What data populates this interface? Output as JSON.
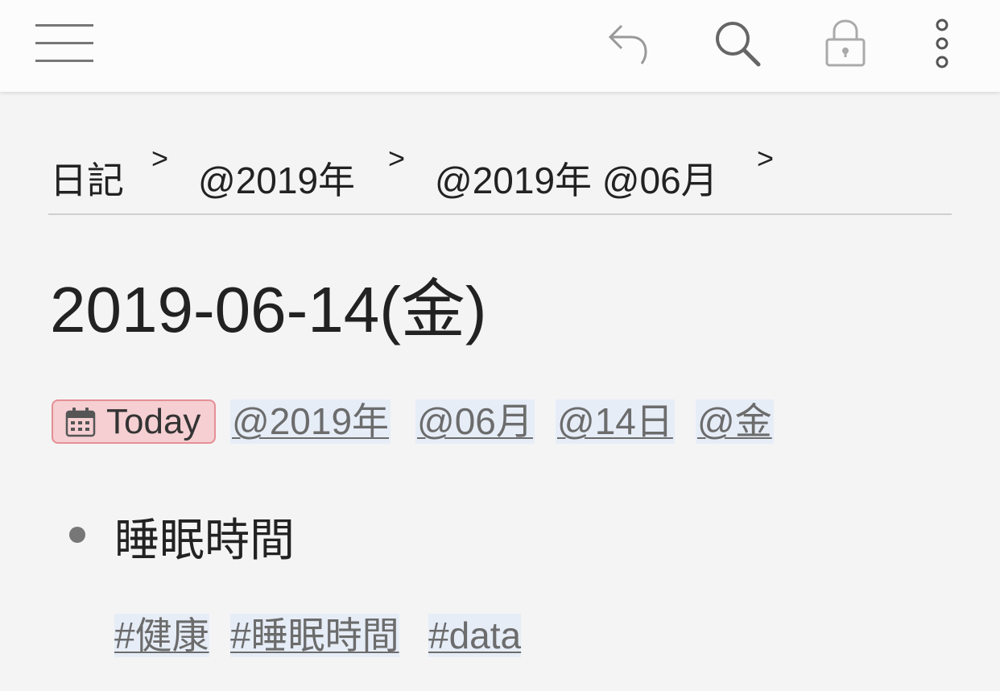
{
  "toolbar": {
    "menu_icon": "hamburger-menu-icon",
    "undo_icon": "undo-arrow-icon",
    "search_icon": "search-icon",
    "lock_icon": "lock-icon",
    "more_icon": "more-vertical-icon"
  },
  "breadcrumb": {
    "items": [
      "日記",
      "@2019年",
      "@2019年 @06月"
    ],
    "separator": ">"
  },
  "page": {
    "title": "2019-06-14(金)"
  },
  "date_tags": {
    "today_label": "Today",
    "today_icon": "calendar-icon",
    "tags": [
      "@2019年",
      "@06月",
      "@14日",
      "@金"
    ]
  },
  "content": {
    "bullet_text": "睡眠時間",
    "hashtags": [
      "#健康",
      "#睡眠時間",
      "#data"
    ]
  },
  "colors": {
    "background": "#f4f4f5",
    "toolbar": "#fcfcfc",
    "today_badge_bg": "#f5cfd2",
    "today_badge_border": "#e58f95",
    "tag_bg": "#e6edf7",
    "tag_text": "#6c6c6c"
  }
}
